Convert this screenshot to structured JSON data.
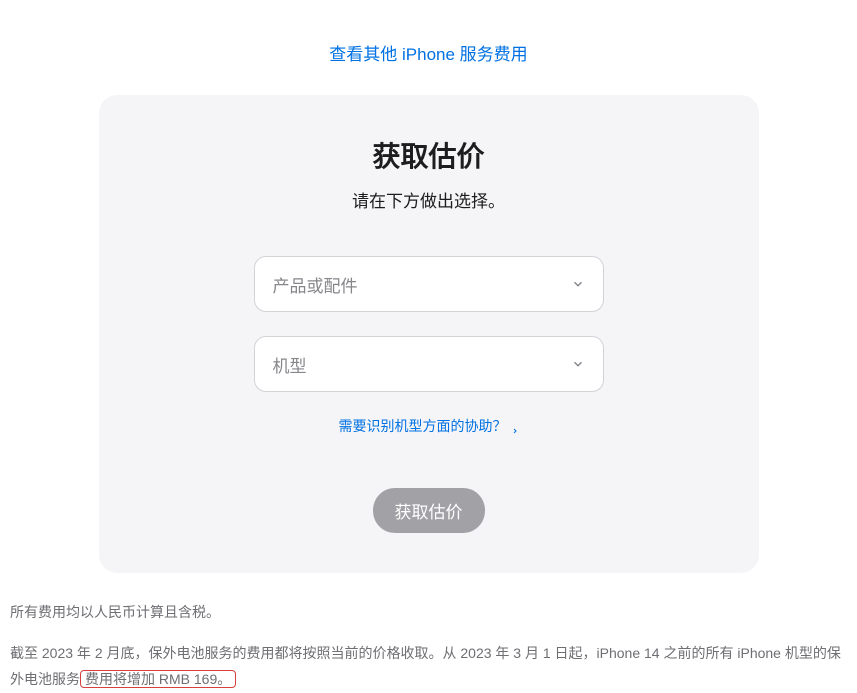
{
  "topLink": {
    "label": "查看其他 iPhone 服务费用"
  },
  "card": {
    "title": "获取估价",
    "subtitle": "请在下方做出选择。",
    "select1": {
      "placeholder": "产品或配件"
    },
    "select2": {
      "placeholder": "机型"
    },
    "helpLink": {
      "label": "需要识别机型方面的协助？"
    },
    "submitButton": {
      "label": "获取估价"
    }
  },
  "footer": {
    "line1": "所有费用均以人民币计算且含税。",
    "line2Part1": "截至 2023 年 2 月底，保外电池服务的费用都将按照当前的价格收取。从 2023 年 3 月 1 日起，iPhone 14 之前的所有 iPhone 机型的保外电池服务",
    "line2Highlight": "费用将增加 RMB 169。"
  }
}
